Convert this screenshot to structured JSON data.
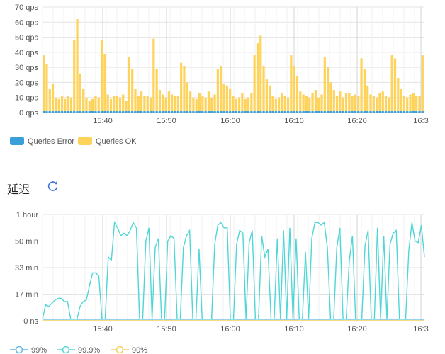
{
  "section_title": "延迟",
  "refresh_icon": "refresh-icon",
  "chart_data": [
    {
      "type": "bar",
      "unit": "qps",
      "stacked": true,
      "ylim": [
        0,
        70
      ],
      "yticks": [
        "0 qps",
        "10 qps",
        "20 qps",
        "30 qps",
        "40 qps",
        "50 qps",
        "60 qps",
        "70 qps"
      ],
      "xticks": [
        "15:40",
        "15:50",
        "16:00",
        "16:10",
        "16:20",
        "16:3"
      ],
      "legend_position": "bottom-left",
      "grid": true,
      "series": [
        {
          "name": "Queries Error",
          "color": "#3a9fd8",
          "values": [
            1,
            1,
            1,
            1,
            1,
            1,
            1,
            1,
            1,
            1,
            1,
            1,
            1,
            1,
            1,
            1,
            1,
            1,
            1,
            1,
            1,
            1,
            1,
            1,
            1,
            1,
            1,
            1,
            1,
            1,
            1,
            1,
            1,
            1,
            1,
            1,
            1,
            1,
            1,
            1,
            1,
            1,
            1,
            1,
            1,
            1,
            1,
            1,
            1,
            1,
            1,
            1,
            1,
            1,
            1,
            1,
            1,
            1,
            1,
            1,
            1,
            1,
            1,
            1,
            1,
            1,
            1,
            1,
            1,
            1,
            1,
            1,
            1,
            1,
            1,
            1,
            1,
            1,
            1,
            1,
            1,
            1,
            1,
            1,
            1,
            1,
            1,
            1,
            1,
            1,
            1,
            1,
            1,
            1,
            1,
            1,
            1,
            1,
            1,
            1,
            1,
            1,
            1,
            1,
            1,
            1,
            1,
            1,
            1,
            1,
            1,
            1,
            1,
            1,
            1,
            1,
            1,
            1,
            1,
            1,
            1,
            1,
            1,
            1,
            1,
            1,
            1,
            1,
            1,
            1,
            1,
            1,
            1,
            1,
            1,
            1,
            1,
            1,
            1,
            1,
            1,
            1,
            1,
            1,
            1,
            1,
            1,
            1,
            1,
            1,
            1,
            1,
            1,
            1,
            1,
            1,
            1,
            1,
            1,
            1,
            1,
            1,
            1,
            1,
            1
          ]
        },
        {
          "name": "Queries OK",
          "color": "#fdd35c",
          "values": [
            37,
            31,
            15,
            18,
            9,
            8,
            10,
            8,
            10,
            9,
            47,
            61,
            25,
            15,
            9,
            7,
            8,
            10,
            9,
            47,
            38,
            11,
            8,
            10,
            10,
            9,
            11,
            7,
            36,
            28,
            15,
            10,
            13,
            10,
            10,
            9,
            48,
            28,
            14,
            11,
            9,
            13,
            11,
            10,
            10,
            32,
            30,
            19,
            13,
            9,
            8,
            12,
            10,
            9,
            13,
            9,
            11,
            28,
            30,
            18,
            17,
            15,
            10,
            8,
            9,
            12,
            8,
            9,
            12,
            37,
            45,
            50,
            30,
            21,
            17,
            10,
            8,
            9,
            12,
            10,
            9,
            37,
            30,
            23,
            13,
            11,
            10,
            9,
            12,
            14,
            9,
            11,
            36,
            29,
            19,
            14,
            10,
            13,
            9,
            12,
            12,
            10,
            11,
            10,
            35,
            28,
            17,
            11,
            10,
            9,
            12,
            13,
            10,
            9,
            37,
            35,
            22,
            15,
            10,
            9,
            11,
            12,
            10,
            10,
            37
          ]
        }
      ]
    },
    {
      "type": "line",
      "yticks": [
        "0 ns",
        "17 min",
        "33 min",
        "50 min",
        "1 hour"
      ],
      "ylim_min": [
        0,
        60
      ],
      "xticks": [
        "15:40",
        "15:50",
        "16:00",
        "16:10",
        "16:20",
        "16:3"
      ],
      "grid": true,
      "legend_position": "bottom-left",
      "series": [
        {
          "name": "99%",
          "color": "#5bb5e6",
          "values": [
            1,
            1,
            1,
            1,
            1,
            1,
            1,
            1,
            1,
            1,
            1,
            1,
            1,
            1,
            1,
            1,
            1,
            1,
            1,
            1,
            1,
            1,
            1,
            1,
            1,
            1,
            1,
            1,
            1,
            1,
            1,
            1,
            1,
            1,
            1,
            1,
            1,
            1,
            1,
            1,
            1,
            1,
            1,
            1,
            1,
            1,
            1,
            1,
            1,
            1,
            1,
            1,
            1,
            1,
            1,
            1,
            1,
            1,
            1,
            1,
            1,
            1,
            1,
            1,
            1,
            1,
            1,
            1,
            1,
            1,
            1,
            1,
            1,
            1,
            1,
            1,
            1,
            1,
            1,
            1,
            1,
            1,
            1,
            1,
            1,
            1,
            1,
            1,
            1,
            1,
            1,
            1,
            1,
            1,
            1,
            1,
            1,
            1,
            1,
            1,
            1,
            1,
            1,
            1,
            1,
            1,
            1,
            1,
            1,
            1,
            1,
            1,
            1,
            1,
            1,
            1,
            1,
            1,
            1,
            1,
            1,
            1,
            1,
            1,
            1
          ]
        },
        {
          "name": "99.9%",
          "color": "#4fd6d6",
          "values": [
            1,
            10,
            9,
            11,
            13,
            14,
            14,
            12,
            12,
            1,
            1,
            1,
            9,
            12,
            13,
            22,
            30,
            30,
            28,
            1,
            1,
            40,
            38,
            57,
            55,
            52,
            53,
            52,
            54,
            57,
            55,
            1,
            1,
            50,
            55,
            1,
            46,
            51,
            1,
            1,
            50,
            52,
            51,
            1,
            1,
            46,
            52,
            54,
            1,
            1,
            45,
            1,
            1,
            1,
            1,
            48,
            56,
            57,
            55,
            55,
            1,
            1,
            48,
            54,
            53,
            1,
            49,
            54,
            1,
            1,
            52,
            40,
            45,
            1,
            1,
            51,
            1,
            54,
            1,
            55,
            1,
            51,
            1,
            1,
            43,
            1,
            51,
            57,
            57,
            56,
            57,
            46,
            1,
            1,
            46,
            55,
            1,
            1,
            38,
            52,
            1,
            1,
            1,
            47,
            54,
            1,
            1,
            55,
            1,
            52,
            1,
            48,
            53,
            54,
            1,
            1,
            1,
            44,
            57,
            50,
            49,
            56,
            40
          ]
        },
        {
          "name": "90%",
          "color": "#f7cf5a",
          "values": [
            0,
            0,
            0,
            0,
            0,
            0,
            0,
            0,
            0,
            0,
            0,
            0,
            0,
            0,
            0,
            0,
            0,
            0,
            0,
            0,
            0,
            0,
            0,
            0,
            0,
            0,
            0,
            0,
            0,
            0,
            0,
            0,
            0,
            0,
            0,
            0,
            0,
            0,
            0,
            0,
            0,
            0,
            0,
            0,
            0,
            0,
            0,
            0,
            0,
            0,
            0,
            0,
            0,
            0,
            0,
            0,
            0,
            0,
            0,
            0,
            0,
            0,
            0,
            0,
            0,
            0,
            0,
            0,
            0,
            0,
            0,
            0,
            0,
            0,
            0,
            0,
            0,
            0,
            0,
            0,
            0,
            0,
            0,
            0,
            0,
            0,
            0,
            0,
            0,
            0,
            0,
            0,
            0,
            0,
            0,
            0,
            0,
            0,
            0,
            0,
            0,
            0,
            0,
            0,
            0,
            0,
            0,
            0,
            0,
            0,
            0,
            0,
            0,
            0,
            0,
            0,
            0,
            0,
            0,
            0,
            0,
            0,
            0,
            0,
            0
          ]
        }
      ]
    }
  ]
}
